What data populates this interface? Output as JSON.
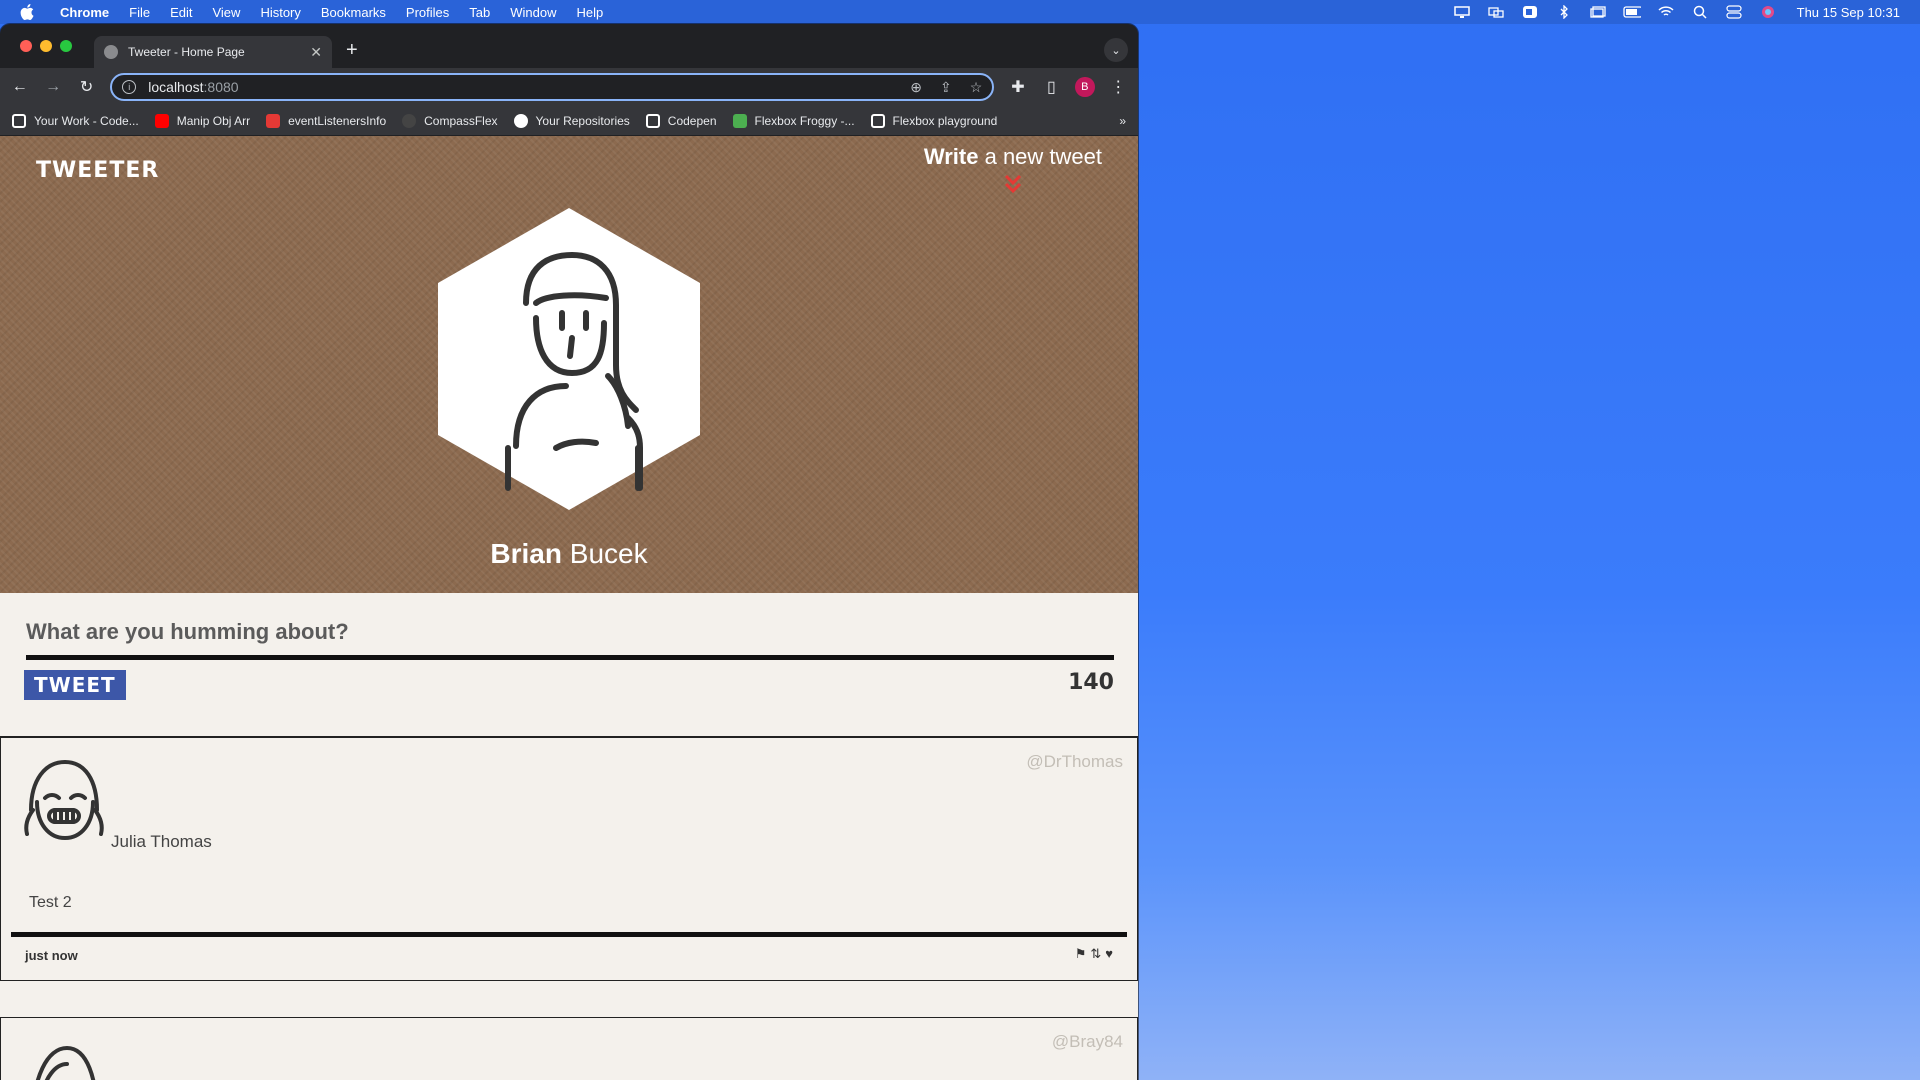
{
  "menubar": {
    "app": "Chrome",
    "items": [
      "File",
      "Edit",
      "View",
      "History",
      "Bookmarks",
      "Profiles",
      "Tab",
      "Window",
      "Help"
    ],
    "clock": "Thu 15 Sep  10:31"
  },
  "browser": {
    "tab_title": "Tweeter - Home Page",
    "url_host": "localhost",
    "url_port": ":8080",
    "profile_initial": "B",
    "bookmarks": [
      {
        "label": "Your Work - Code...",
        "color": "#ffffff"
      },
      {
        "label": "Manip Obj Arr",
        "color": "#ff0000"
      },
      {
        "label": "eventListenersInfo",
        "color": "#e53935"
      },
      {
        "label": "CompassFlex",
        "color": "#444444"
      },
      {
        "label": "Your Repositories",
        "color": "#ffffff"
      },
      {
        "label": "Codepen",
        "color": "#ffffff"
      },
      {
        "label": "Flexbox Froggy -...",
        "color": "#4caf50"
      },
      {
        "label": "Flexbox playground",
        "color": "#ffffff"
      }
    ],
    "more": "»"
  },
  "page": {
    "brand": "TWEETER",
    "write_bold": "Write",
    "write_rest": " a new tweet",
    "user_first": "Brian",
    "user_last": " Bucek",
    "compose_placeholder": "What are you humming about?",
    "tweet_button": "TWEET",
    "counter": "140",
    "colors": {
      "hero": "#8c6a4f",
      "button": "#3d57a8",
      "chevron": "#e53935"
    }
  },
  "tweets": [
    {
      "handle": "@DrThomas",
      "name": "Julia Thomas",
      "content": "Test 2",
      "time": "just now"
    },
    {
      "handle": "@Bray84"
    }
  ]
}
